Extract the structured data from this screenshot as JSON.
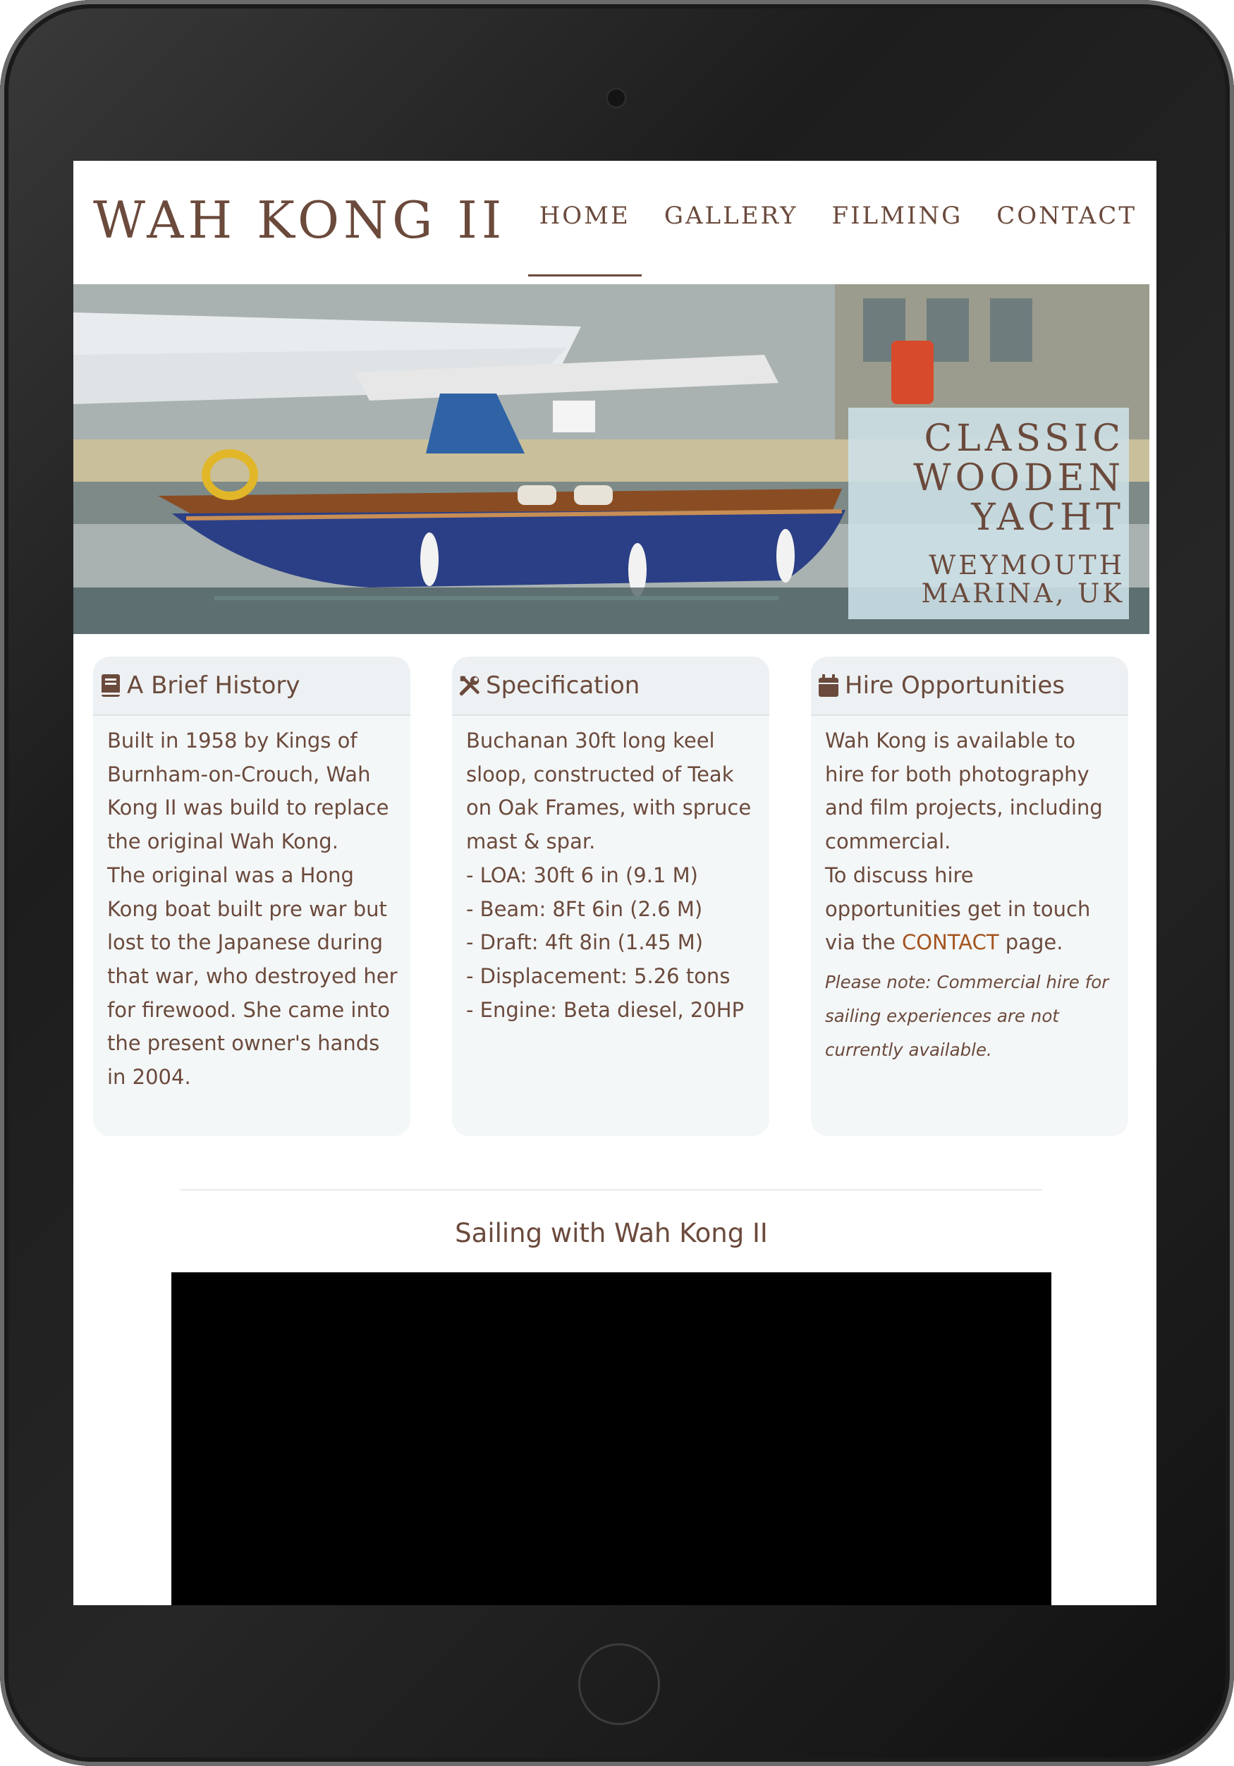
{
  "header": {
    "brand": "WAH KONG II",
    "nav": [
      {
        "label": "HOME",
        "active": true
      },
      {
        "label": "GALLERY",
        "active": false
      },
      {
        "label": "FILMING",
        "active": false
      },
      {
        "label": "CONTACT",
        "active": false
      }
    ]
  },
  "hero": {
    "title_lines": [
      "CLASSIC",
      "WOODEN",
      "YACHT"
    ],
    "subtitle_lines": [
      "WEYMOUTH",
      "MARINA, UK"
    ]
  },
  "cards": [
    {
      "icon": "book-icon",
      "title": "A Brief History",
      "lines": [
        "Built in 1958 by Kings of",
        "Burnham-on-Crouch, Wah",
        "Kong II was build to replace",
        "the original Wah Kong.",
        "The original was a Hong",
        "Kong boat built pre war but",
        "lost to the Japanese during",
        "that war, who destroyed her",
        "for firewood. She came into",
        "the present owner's hands",
        "in 2004."
      ]
    },
    {
      "icon": "tools-icon",
      "title": "Specification",
      "lines": [
        "Buchanan 30ft long keel",
        "sloop, constructed of Teak",
        "on Oak Frames, with spruce",
        "mast & spar.",
        "- LOA: 30ft 6 in (9.1 M)",
        "- Beam: 8Ft 6in (2.6 M)",
        "- Draft: 4ft 8in (1.45 M)",
        "- Displacement: 5.26 tons",
        "- Engine: Beta diesel, 20HP"
      ]
    },
    {
      "icon": "calendar-icon",
      "title": "Hire Opportunities",
      "lines": [
        "Wah Kong is available to",
        "hire for both photography",
        "and film projects, including",
        "commercial.",
        "To discuss hire",
        "opportunities get in touch"
      ],
      "link_line": {
        "before": "via the ",
        "link": "CONTACT",
        "after": " page."
      },
      "note_lines": [
        "Please note: Commercial hire for",
        "sailing experiences are not",
        "currently available."
      ]
    }
  ],
  "video": {
    "title": "Sailing with Wah Kong II"
  },
  "colors": {
    "text": "#6b4a3c",
    "link": "#a4541f",
    "card_bg": "#f4f7f8",
    "card_head_bg": "#edf1f3",
    "hull": "#2b3f86",
    "hero_box": "#cde1e8"
  }
}
